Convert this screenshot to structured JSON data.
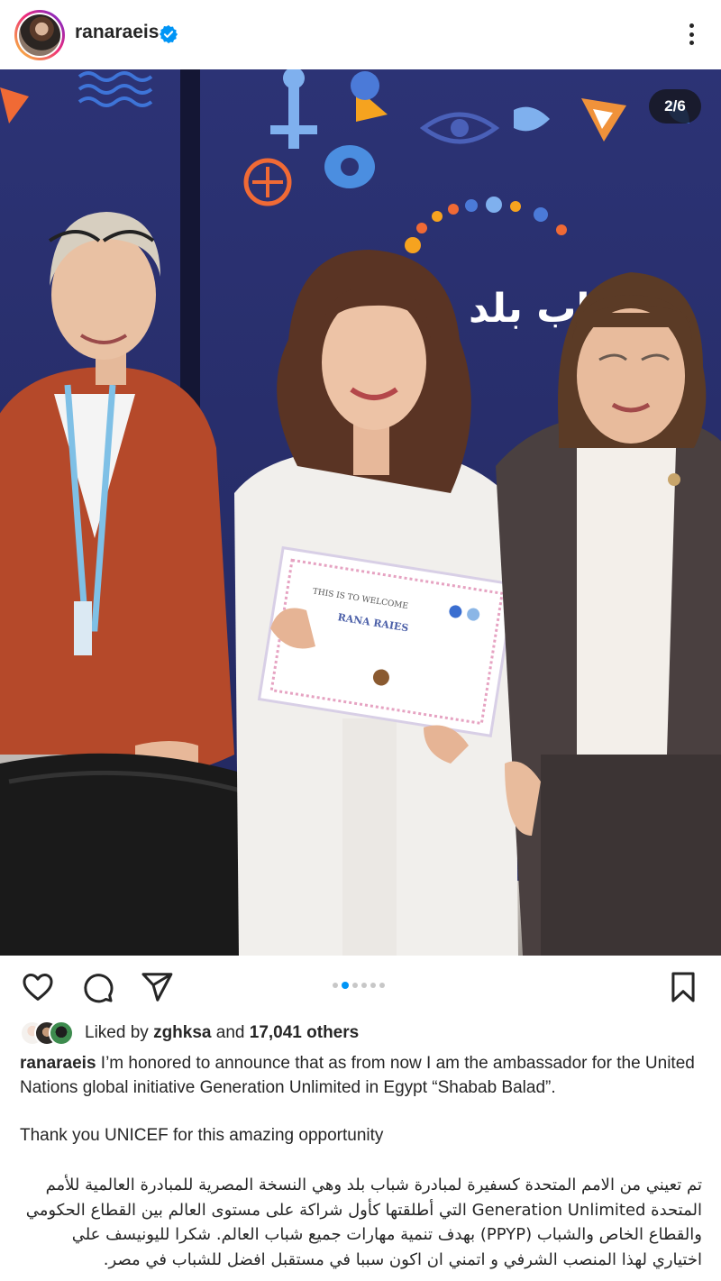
{
  "header": {
    "username": "ranaraeis",
    "verified": true,
    "more_icon": "more-vertical-icon"
  },
  "post": {
    "counter": "2/6",
    "slide_count": 6,
    "active_slide": 2,
    "photo": {
      "backdrop_text": "شباب بلد",
      "certificate_title": "THIS IS TO WELCOME",
      "certificate_name": "RANA RAIES"
    }
  },
  "actions": {
    "like_icon": "heart-icon",
    "comment_icon": "comment-icon",
    "share_icon": "send-icon",
    "save_icon": "bookmark-icon"
  },
  "likes": {
    "prefix": "Liked by",
    "user": "zghksa",
    "conjunction": "and",
    "others": "17,041 others"
  },
  "caption": {
    "username": "ranaraeis",
    "text": "I’m honored to announce that as from now I am the ambassador for the United Nations global initiative Generation Unlimited in Egypt “Shabab Balad”.",
    "line2": "Thank you UNICEF for this amazing opportunity",
    "arabic": "تم تعيني من الامم المتحدة كسفيرة لمبادرة شباب بلد وهي النسخة المصرية للمبادرة العالمية للأمم المتحدة Generation Unlimited التي أطلقتها كأول شراكة على مستوى العالم بين القطاع الحكومي والقطاع الخاص والشباب (PPYP) بهدف تنمية مهارات جميع شباب العالم. شكرا لليونيسف علي اختياري لهذا المنصب الشرفي و اتمني ان اكون سببا في مستقبل افضل للشباب في مصر."
  },
  "colors": {
    "accent": "#0095f6",
    "text": "#262626",
    "backdrop": "#2a2f6e"
  }
}
